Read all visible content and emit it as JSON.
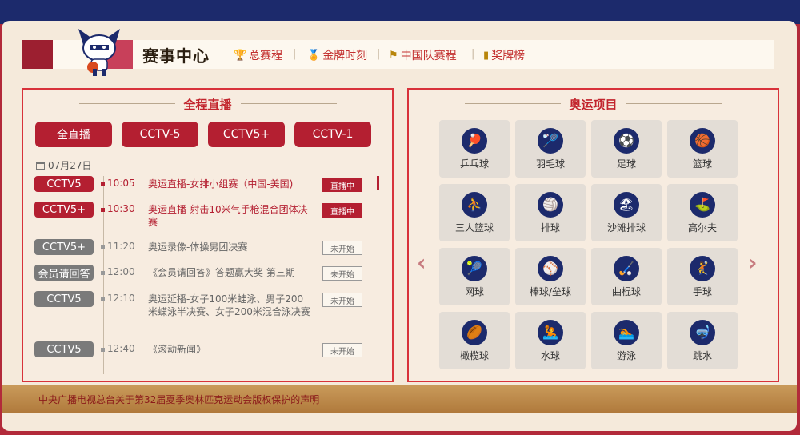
{
  "header": {
    "title": "赛事中心",
    "nav": [
      {
        "label": "总赛程",
        "icon": "trophy-icon"
      },
      {
        "label": "金牌时刻",
        "icon": "medal-icon"
      },
      {
        "label": "中国队赛程",
        "icon": "flag-icon"
      },
      {
        "label": "奖牌榜",
        "icon": "bar-chart-icon"
      }
    ]
  },
  "live": {
    "title": "全程直播",
    "tabs": [
      "全直播",
      "CCTV-5",
      "CCTV5+",
      "CCTV-1"
    ],
    "date": "07月27日",
    "schedule": [
      {
        "channel": "CCTV5",
        "time": "10:05",
        "program": "奥运直播-女排小组赛（中国-美国)",
        "status": "直播中",
        "live": true
      },
      {
        "channel": "CCTV5+",
        "time": "10:30",
        "program": "奥运直播-射击10米气手枪混合团体决赛",
        "status": "直播中",
        "live": true
      },
      {
        "channel": "CCTV5+",
        "time": "11:20",
        "program": "奥运录像-体操男团决赛",
        "status": "未开始",
        "live": false
      },
      {
        "channel": "会员请回答",
        "time": "12:00",
        "program": "《会员请回答》答题赢大奖 第三期",
        "status": "未开始",
        "live": false
      },
      {
        "channel": "CCTV5",
        "time": "12:10",
        "program": "奥运延播-女子100米蛙泳、男子200米蝶泳半决赛、女子200米混合泳决赛",
        "status": "未开始",
        "live": false
      },
      {
        "channel": "CCTV5",
        "time": "12:40",
        "program": "《滚动新闻》",
        "status": "未开始",
        "live": false
      }
    ]
  },
  "sports": {
    "title": "奥运项目",
    "items": [
      {
        "label": "乒乓球",
        "icon": "table-tennis-icon",
        "glyph": "🏓"
      },
      {
        "label": "羽毛球",
        "icon": "badminton-icon",
        "glyph": "🏸"
      },
      {
        "label": "足球",
        "icon": "football-icon",
        "glyph": "⚽"
      },
      {
        "label": "篮球",
        "icon": "basketball-icon",
        "glyph": "🏀"
      },
      {
        "label": "三人篮球",
        "icon": "basketball-3x3-icon",
        "glyph": "⛹"
      },
      {
        "label": "排球",
        "icon": "volleyball-icon",
        "glyph": "🏐"
      },
      {
        "label": "沙滩排球",
        "icon": "beach-volleyball-icon",
        "glyph": "🏖"
      },
      {
        "label": "高尔夫",
        "icon": "golf-icon",
        "glyph": "⛳"
      },
      {
        "label": "网球",
        "icon": "tennis-icon",
        "glyph": "🎾"
      },
      {
        "label": "棒球/垒球",
        "icon": "baseball-icon",
        "glyph": "⚾"
      },
      {
        "label": "曲棍球",
        "icon": "hockey-icon",
        "glyph": "🏑"
      },
      {
        "label": "手球",
        "icon": "handball-icon",
        "glyph": "🤾"
      },
      {
        "label": "橄榄球",
        "icon": "rugby-icon",
        "glyph": "🏉"
      },
      {
        "label": "水球",
        "icon": "water-polo-icon",
        "glyph": "🤽"
      },
      {
        "label": "游泳",
        "icon": "swimming-icon",
        "glyph": "🏊"
      },
      {
        "label": "跳水",
        "icon": "diving-icon",
        "glyph": "🤿"
      }
    ]
  },
  "footer": {
    "text": "中央广播电视总台关于第32届夏季奥林匹克运动会版权保护的声明"
  },
  "colors": {
    "brand_red": "#b41f31",
    "navy": "#1c2a6c",
    "panel": "#f5eadb"
  }
}
